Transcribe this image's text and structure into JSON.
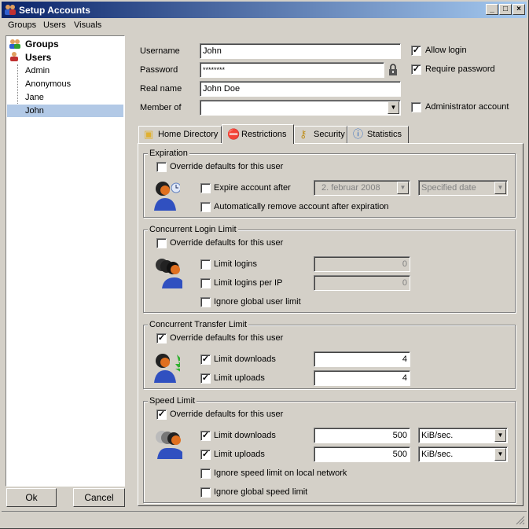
{
  "window": {
    "title": "Setup Accounts",
    "min": "_",
    "max": "□",
    "close": "×"
  },
  "menu": [
    "Groups",
    "Users",
    "Visuals"
  ],
  "tree": {
    "groups": "Groups",
    "users": "Users",
    "items": [
      "Admin",
      "Anonymous",
      "Jane",
      "John"
    ]
  },
  "buttons": {
    "ok": "Ok",
    "cancel": "Cancel"
  },
  "account": {
    "username_label": "Username",
    "username": "John",
    "password_label": "Password",
    "password": "********",
    "realname_label": "Real name",
    "realname": "John Doe",
    "member_label": "Member of",
    "member": "",
    "allow_login": "Allow login",
    "require_password": "Require password",
    "admin_account": "Administrator account"
  },
  "tabs": [
    "Home Directory",
    "Restrictions",
    "Security",
    "Statistics"
  ],
  "expiration": {
    "title": "Expiration",
    "override": "Override defaults for this user",
    "expire_after": "Expire account after",
    "date": "2.  februar  2008",
    "date_mode": "Specified date",
    "auto_remove": "Automatically remove account after expiration"
  },
  "login_limit": {
    "title": "Concurrent Login Limit",
    "override": "Override defaults for this user",
    "limit_logins": "Limit logins",
    "limit_logins_val": "0",
    "limit_per_ip": "Limit logins per IP",
    "limit_per_ip_val": "0",
    "ignore_global": "Ignore global user limit"
  },
  "transfer_limit": {
    "title": "Concurrent Transfer Limit",
    "override": "Override defaults for this user",
    "limit_downloads": "Limit downloads",
    "downloads_val": "4",
    "limit_uploads": "Limit uploads",
    "uploads_val": "4"
  },
  "speed_limit": {
    "title": "Speed Limit",
    "override": "Override defaults for this user",
    "limit_downloads": "Limit downloads",
    "downloads_val": "500",
    "downloads_unit": "KiB/sec.",
    "limit_uploads": "Limit uploads",
    "uploads_val": "500",
    "uploads_unit": "KiB/sec.",
    "ignore_local": "Ignore speed limit on local network",
    "ignore_global": "Ignore global speed limit"
  },
  "check": "✓",
  "arrow": "▼",
  "colors": {
    "title_start": "#0a246a",
    "title_end": "#a6caf0",
    "selection": "#b2c9e6"
  }
}
